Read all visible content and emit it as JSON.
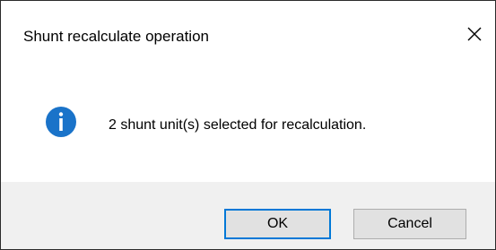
{
  "dialog": {
    "title": "Shunt recalculate operation",
    "close_icon": "close-icon",
    "message_icon": "info-icon",
    "message": "2 shunt unit(s) selected for recalculation.",
    "buttons": {
      "ok_label": "OK",
      "cancel_label": "Cancel"
    },
    "colors": {
      "info_icon_fill": "#1a73c9",
      "default_button_border": "#0078d7",
      "footer_background": "#f0f0f0"
    }
  }
}
